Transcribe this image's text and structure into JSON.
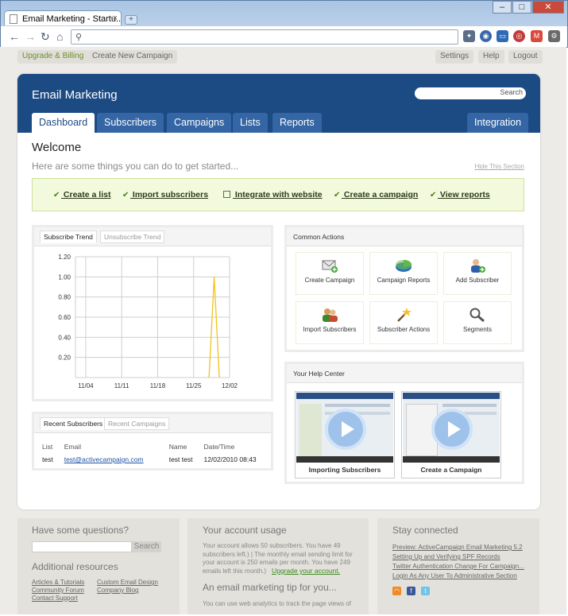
{
  "browser": {
    "tab_title": "Email Marketing - Startu...",
    "tab_close": "×",
    "newtab": "+",
    "window": {
      "minimize": "–",
      "maximize": "□",
      "close": "✕"
    },
    "nav": {
      "back": "←",
      "forward": "→",
      "reload": "↻",
      "home": "⌂"
    },
    "omnibox_value": "",
    "extensions": [
      "puzzle-icon",
      "globe-icon",
      "monitor-icon",
      "target-icon",
      "gmail-icon",
      "wrench-icon"
    ]
  },
  "topbar": {
    "upgrade": "Upgrade & Billing",
    "create_campaign": "Create New Campaign",
    "settings": "Settings",
    "help": "Help",
    "logout": "Logout"
  },
  "header": {
    "title": "Email Marketing",
    "search_button": "Search",
    "search_value": "",
    "tabs": [
      "Dashboard",
      "Subscribers",
      "Campaigns",
      "Lists",
      "Reports"
    ],
    "integration": "Integration",
    "active_tab": "Dashboard"
  },
  "welcome": {
    "title": "Welcome",
    "subtitle": "Here are some things you can do to get started...",
    "hide": "Hide This Section"
  },
  "quick_actions": [
    {
      "label": "Create a list",
      "done": true
    },
    {
      "label": "Import subscribers",
      "done": true
    },
    {
      "label": "Integrate with website",
      "done": false
    },
    {
      "label": "Create a campaign",
      "done": true
    },
    {
      "label": "View reports",
      "done": true
    }
  ],
  "trend": {
    "tabs": [
      "Subscribe Trend",
      "Unsubscribe Trend"
    ],
    "active_tab": "Subscribe Trend"
  },
  "chart_data": {
    "type": "line",
    "x": [
      "11/04",
      "11/11",
      "11/18",
      "11/25",
      "12/02"
    ],
    "y_ticks": [
      0.2,
      0.4,
      0.6,
      0.8,
      1.0,
      1.2
    ],
    "y_tick_labels": [
      "0.20",
      "0.40",
      "0.60",
      "0.80",
      "1.00",
      "1.20"
    ],
    "ylim": [
      0,
      1.2
    ],
    "xlim_days": [
      0,
      30
    ],
    "series": [
      {
        "days": [
          26,
          27,
          28
        ],
        "values": [
          0,
          1.0,
          0
        ]
      }
    ],
    "grid": true,
    "colors": {
      "line": "#f0c419",
      "grid": "#cfcfcf"
    }
  },
  "recent": {
    "tabs": [
      "Recent Subscribers",
      "Recent Campaigns"
    ],
    "columns": [
      "List",
      "Email",
      "Name",
      "Date/Time"
    ],
    "rows": [
      {
        "list": "test",
        "email": "test@activecampaign.com",
        "name": "test test",
        "datetime": "12/02/2010 08:43"
      }
    ]
  },
  "common_actions": {
    "title": "Common Actions",
    "items": [
      {
        "label": "Create Campaign",
        "icon": "create-campaign-icon"
      },
      {
        "label": "Campaign Reports",
        "icon": "campaign-reports-icon"
      },
      {
        "label": "Add Subscriber",
        "icon": "add-subscriber-icon"
      },
      {
        "label": "Import Subscribers",
        "icon": "import-subscribers-icon"
      },
      {
        "label": "Subscriber Actions",
        "icon": "subscriber-actions-icon"
      },
      {
        "label": "Segments",
        "icon": "segments-icon"
      }
    ]
  },
  "help_center": {
    "title": "Your Help Center",
    "videos": [
      "Importing Subscribers",
      "Create a Campaign"
    ]
  },
  "footer": {
    "questions": {
      "title": "Have some questions?",
      "search_button": "Search",
      "resources_title": "Additional resources",
      "links": [
        "Articles & Tutorials",
        "Custom Email Design",
        "Community Forum",
        "Company Blog",
        "Contact Support"
      ]
    },
    "account": {
      "title": "Your account usage",
      "text": "Your account allows 50 subscribers. You have 49 subscribers left.) | The monthly email sending limit for your account is 250 emails per month. You have 249 emails left this month.)",
      "upgrade_link": "Upgrade your account.",
      "tip_title": "An email marketing tip for you...",
      "tip_text": "You can use web analytics to track the page views of"
    },
    "connected": {
      "title": "Stay connected",
      "links": [
        "Preview: ActiveCampaign Email Marketing 5.2",
        "Setting Up and Verifying SPF Records",
        "Twitter Authentication Change For Campaign...",
        "Login As Any User To Administrative Section"
      ]
    }
  }
}
